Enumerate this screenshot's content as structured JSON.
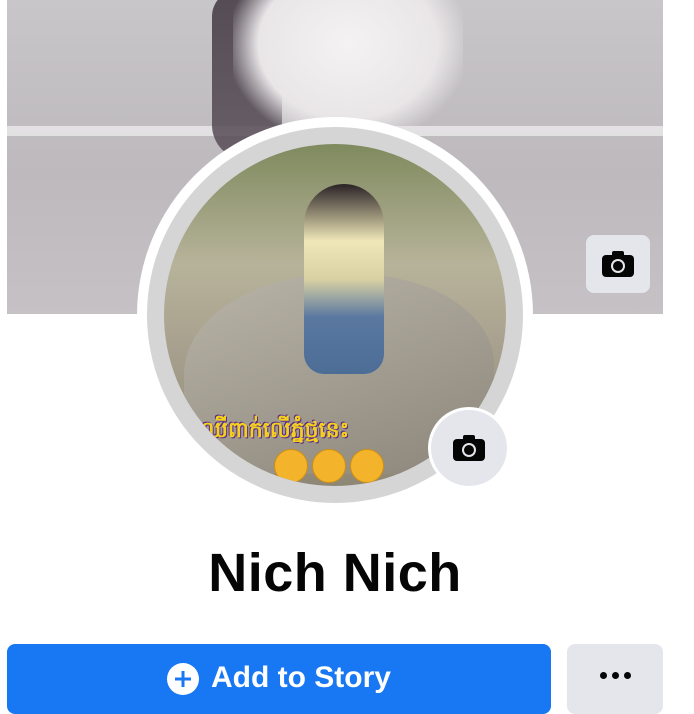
{
  "profile": {
    "name": "Nich Nich",
    "photo_caption": "ឈើពាក់លើភ្នំថ្មនេះ",
    "accent_color": "#1877f2"
  },
  "cover": {
    "camera_icon": "camera-icon"
  },
  "profile_picture": {
    "camera_icon": "camera-icon"
  },
  "actions": {
    "add_story_label": "Add to Story",
    "add_story_icon": "plus-circle-icon",
    "more_icon": "more-horizontal-icon"
  }
}
